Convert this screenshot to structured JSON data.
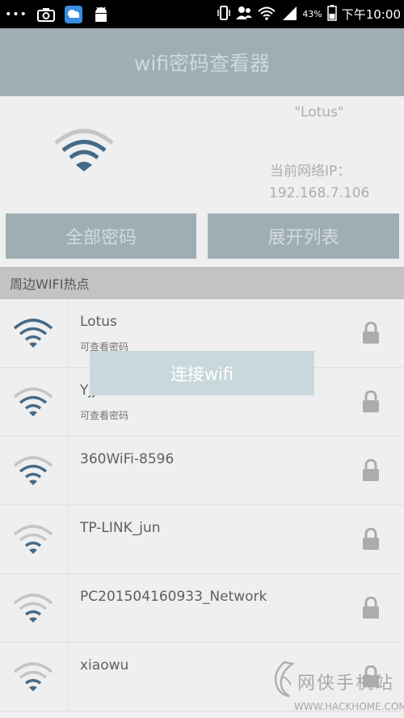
{
  "status_bar": {
    "dots": "•••",
    "battery_percent": "43%",
    "time": "下午10:00",
    "icons": [
      "camera-icon",
      "weather-icon",
      "android-icon",
      "vibrate-icon",
      "contacts-icon",
      "wifi-icon",
      "signal-icon",
      "battery-icon"
    ]
  },
  "title": "wifi密码查看器",
  "current": {
    "ssid": "\"Lotus\"",
    "ip_label": "当前网络IP：",
    "ip_value": "192.168.7.106"
  },
  "buttons": {
    "all_passwords": "全部密码",
    "expand_list": "展开列表"
  },
  "section_title": "周边WIFI热点",
  "networks": [
    {
      "name": "Lotus",
      "sub": "可查看密码",
      "strength": 4
    },
    {
      "name": "Yjj",
      "sub": "可查看密码",
      "strength": 3
    },
    {
      "name": "360WiFi-8596",
      "sub": "",
      "strength": 3
    },
    {
      "name": "TP-LINK_jun",
      "sub": "",
      "strength": 2
    },
    {
      "name": "PC201504160933_Network",
      "sub": "",
      "strength": 2
    },
    {
      "name": "xiaowu",
      "sub": "",
      "strength": 2
    }
  ],
  "dialog": {
    "label": "连接wifi"
  },
  "watermark": {
    "name": "网侠手机站",
    "url": "WWW.HACKHOME.COM"
  },
  "colors": {
    "title_bar": "#8a9da3",
    "wifi_active": "#1d4a6e",
    "wifi_inactive": "#b9b9b9"
  }
}
